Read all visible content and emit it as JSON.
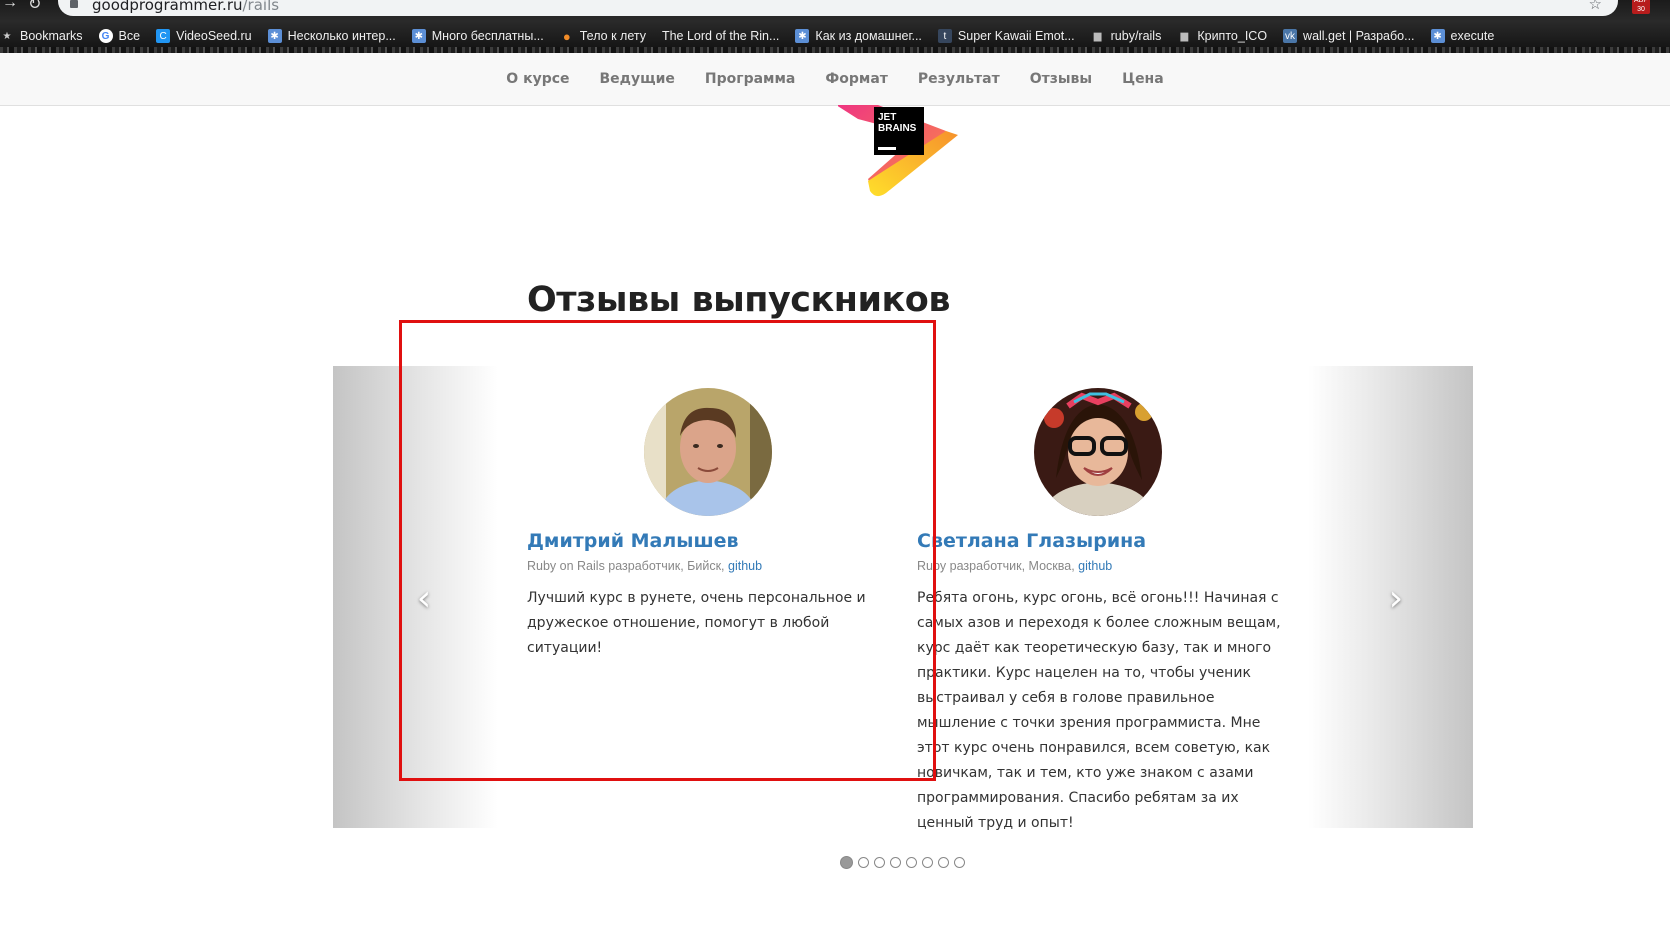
{
  "browser": {
    "url_host": "goodprogrammer.ru",
    "url_path": "/rails",
    "extension_badge": "ABP 30",
    "bookmarks": [
      {
        "label": "Bookmarks",
        "icon": "star-icon",
        "color": "#cccccc"
      },
      {
        "label": "Все",
        "icon": "google-icon",
        "color": "#ffffff"
      },
      {
        "label": "VideoSeed.ru",
        "icon": "videoseed-icon",
        "color": "#2196f3"
      },
      {
        "label": "Несколько интер...",
        "icon": "snowflake-icon",
        "color": "#5c8fd6"
      },
      {
        "label": "Много бесплатны...",
        "icon": "snowflake-icon",
        "color": "#5c8fd6"
      },
      {
        "label": "Тело к лету",
        "icon": "orange-icon",
        "color": "#f28c28"
      },
      {
        "label": "The Lord of the Rin...",
        "icon": "",
        "color": ""
      },
      {
        "label": "Как из домашнег...",
        "icon": "snowflake-icon",
        "color": "#5c8fd6"
      },
      {
        "label": "Super Kawaii Emot...",
        "icon": "tumblr-icon",
        "color": "#36465d"
      },
      {
        "label": "ruby/rails",
        "icon": "folder-icon",
        "color": "#bbbbbb"
      },
      {
        "label": "Крипто_ICO",
        "icon": "folder-icon",
        "color": "#bbbbbb"
      },
      {
        "label": "wall.get | Разрабо...",
        "icon": "vk-icon",
        "color": "#4a76a8"
      },
      {
        "label": "execute",
        "icon": "snowflake-icon",
        "color": "#5c8fd6"
      }
    ]
  },
  "nav": {
    "items": [
      "О курсе",
      "Ведущие",
      "Программа",
      "Формат",
      "Результат",
      "Отзывы",
      "Цена"
    ]
  },
  "logo": {
    "line1": "JET",
    "line2": "BRAINS"
  },
  "section": {
    "title": "Отзывы выпускников"
  },
  "reviews": [
    {
      "name": "Дмитрий Малышев",
      "role": "Ruby on Rails разработчик, Бийск,",
      "link": "github",
      "text": "Лучший курс в рунете, очень персональное и дружеское отношение, помогут в любой ситуации!"
    },
    {
      "name": "Светлана Глазырина",
      "role": "Ruby разработчик, Москва,",
      "link": "github",
      "text": "Ребята огонь, курс огонь, всё огонь!!! Начиная с самых азов и переходя к более сложным вещам, курс даёт как теоретическую базу, так и много практики. Курс нацелен на то, чтобы ученик выстраивал у себя в голове правильное мышление с точки зрения программиста. Мне этот курс очень понравился, всем советую, как новичкам, так и тем, кто уже знаком с азами программирования. Спасибо ребятам за их ценный труд и опыт!"
    }
  ],
  "carousel": {
    "prev": "‹",
    "next": "›",
    "dot_count": 8,
    "active_dot": 1
  },
  "colors": {
    "link": "#337ab7",
    "annotation": "#e01010"
  }
}
